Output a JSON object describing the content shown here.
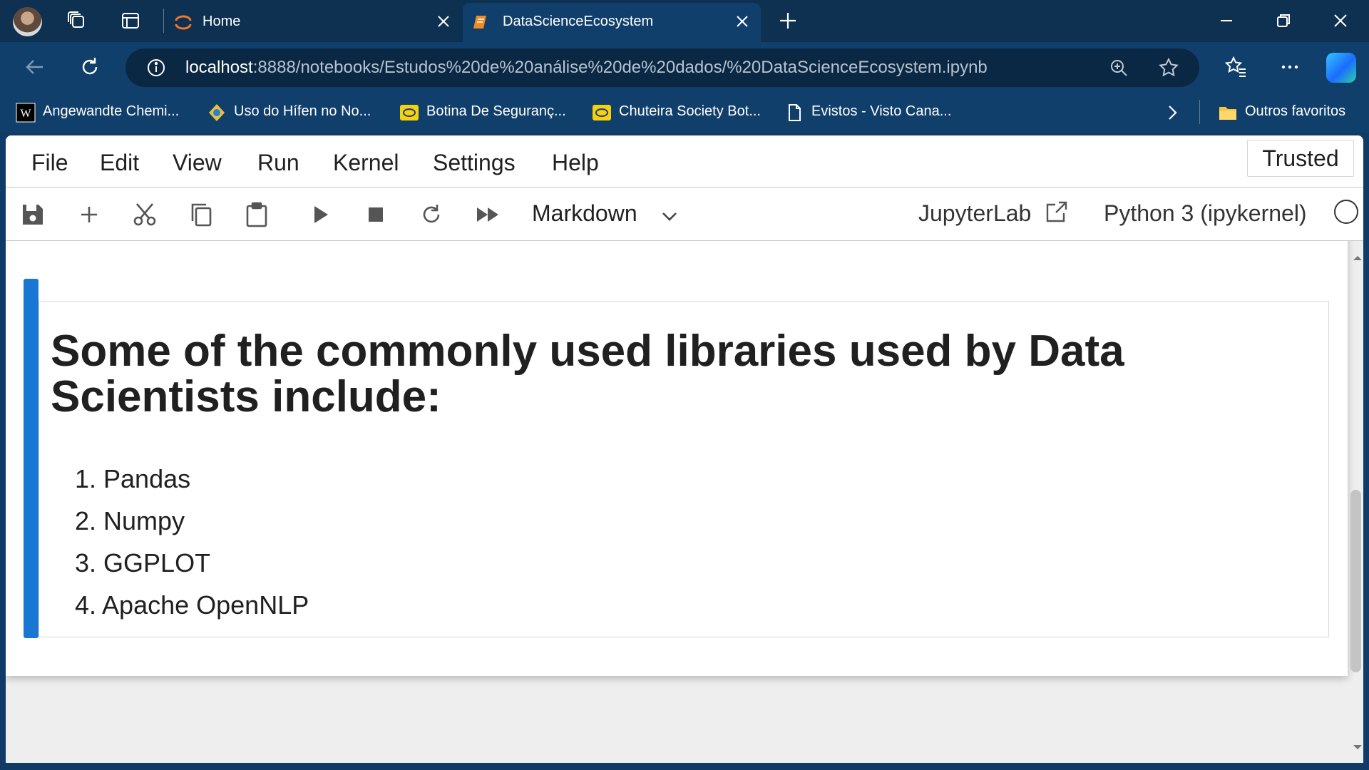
{
  "browser": {
    "tabs": [
      {
        "title": "Home",
        "active": false
      },
      {
        "title": "DataScienceEcosystem",
        "active": true
      }
    ],
    "address": {
      "host": "localhost",
      "path": ":8888/notebooks/Estudos%20de%20análise%20de%20dados/%20DataScienceEcosystem.ipynb"
    },
    "bookmarks": [
      {
        "label": "Angewandte Chemi...",
        "icon": "wiley-icon"
      },
      {
        "label": "Uso do Hífen no No...",
        "icon": "site-icon"
      },
      {
        "label": "Botina De Seguranç...",
        "icon": "shop-icon"
      },
      {
        "label": "Chuteira Society Bot...",
        "icon": "shop-icon"
      },
      {
        "label": "Evistos - Visto Cana...",
        "icon": "page-icon"
      }
    ],
    "other_favorites": "Outros favoritos"
  },
  "jupyter": {
    "menu": [
      "File",
      "Edit",
      "View",
      "Run",
      "Kernel",
      "Settings",
      "Help"
    ],
    "trusted": "Trusted",
    "cell_type": "Markdown",
    "open_in": "JupyterLab",
    "kernel": "Python 3 (ipykernel)"
  },
  "cell": {
    "heading": "Some of the commonly used libraries used by Data Scientists include:",
    "items": [
      "1. Pandas",
      "2. Numpy",
      "3. GGPLOT",
      "4. Apache OpenNLP"
    ]
  },
  "colors": {
    "accent": "#1976d2",
    "chrome_dark": "#0e3152",
    "chrome": "#113f6b"
  }
}
